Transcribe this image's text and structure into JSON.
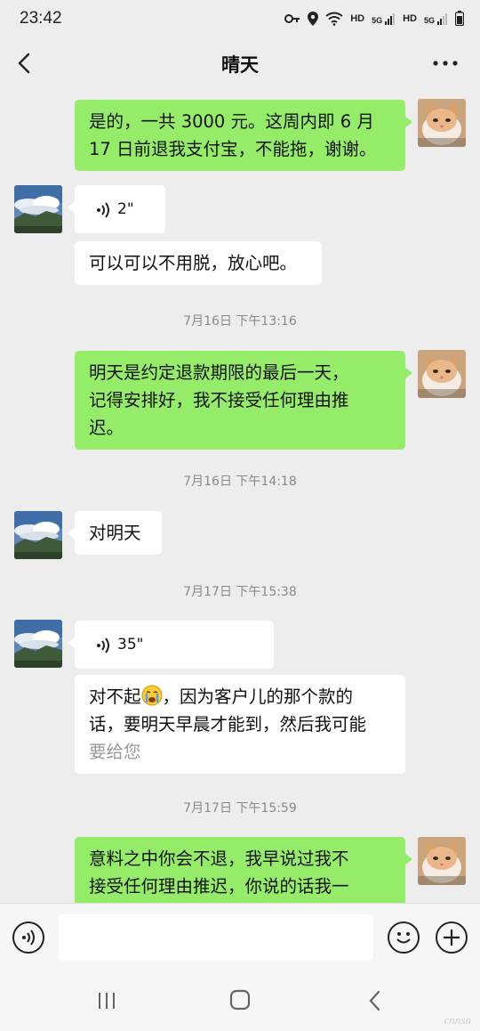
{
  "status": {
    "time": "23:42",
    "hd1": "HD",
    "sig1": "5G",
    "hd2": "HD",
    "sig2": "5G"
  },
  "header": {
    "title": "晴天"
  },
  "messages": {
    "m1": {
      "line1": "是的，一共 3000 元。这周内即 6 月",
      "line2": "17 日前退我支付宝，不能拖，谢谢。"
    },
    "m2": {
      "duration": "2\""
    },
    "m3": {
      "text": "可以可以不用脱，放心吧。"
    },
    "ts1": "7月16日 下午13:16",
    "m4": {
      "line1": "明天是约定退款期限的最后一天，",
      "line2": "记得安排好，我不接受任何理由推",
      "line3": "迟。"
    },
    "ts2": "7月16日 下午14:18",
    "m5": {
      "text": "对明天"
    },
    "ts3": "7月17日 下午15:38",
    "m6": {
      "duration": "35\""
    },
    "m7": {
      "line1_a": "对不起",
      "line1_b": "，因为客户儿的那个款的",
      "line2": "话，要明天早晨才能到，然后我可能",
      "line3": "要给您"
    },
    "ts4": "7月17日 下午15:59",
    "m8": {
      "line1": "意料之中你会不退，我早说过我不",
      "line2": "接受任何理由推迟，你说的话我一"
    }
  },
  "watermark": "cnnsn"
}
